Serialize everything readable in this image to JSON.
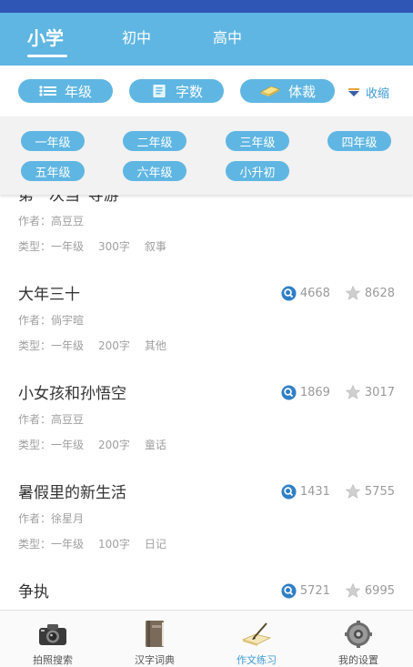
{
  "top_tabs": [
    {
      "label": "小学",
      "active": true
    },
    {
      "label": "初中",
      "active": false
    },
    {
      "label": "高中",
      "active": false
    }
  ],
  "filters": {
    "grade_label": "年级",
    "wordcount_label": "字数",
    "genre_label": "体裁",
    "collapse_label": "收缩"
  },
  "grades": [
    "一年级",
    "二年级",
    "三年级",
    "四年级",
    "五年级",
    "六年级",
    "小升初"
  ],
  "articles": [
    {
      "title": "第一次当“导游”",
      "author": "作者：高豆豆",
      "type_prefix": "类型：一年级",
      "words": "300字",
      "genre": "叙事",
      "views": "",
      "stars": ""
    },
    {
      "title": "大年三十",
      "author": "作者：倘宇暄",
      "type_prefix": "类型：一年级",
      "words": "200字",
      "genre": "其他",
      "views": "4668",
      "stars": "8628"
    },
    {
      "title": "小女孩和孙悟空",
      "author": "作者：高豆豆",
      "type_prefix": "类型：一年级",
      "words": "200字",
      "genre": "童话",
      "views": "1869",
      "stars": "3017"
    },
    {
      "title": "暑假里的新生活",
      "author": "作者：徐星月",
      "type_prefix": "类型：一年级",
      "words": "100字",
      "genre": "日记",
      "views": "1431",
      "stars": "5755"
    },
    {
      "title": "争执",
      "author": "",
      "type_prefix": "",
      "words": "",
      "genre": "",
      "views": "5721",
      "stars": "6995"
    }
  ],
  "bottom_tabs": [
    {
      "label": "拍照搜索",
      "icon": "camera-icon",
      "active": false
    },
    {
      "label": "汉字词典",
      "icon": "book-icon",
      "active": false
    },
    {
      "label": "作文练习",
      "icon": "writing-icon",
      "active": true
    },
    {
      "label": "我的设置",
      "icon": "gear-icon",
      "active": false
    }
  ],
  "colors": {
    "primary": "#5fb6e2",
    "accent": "#3b9ad6",
    "star": "#c9c9c9",
    "view": "#2f7fc7"
  }
}
